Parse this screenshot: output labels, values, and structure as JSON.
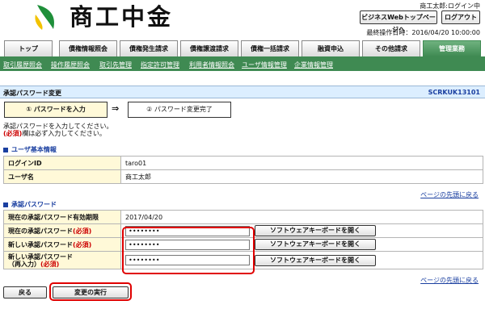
{
  "header": {
    "logo_text": "商工中金",
    "user_status": "商工太郎:ログイン中",
    "webtop_button": "ビジネスWebトップページへ",
    "logout_button": "ログアウト",
    "last_operation": "最終操作日時：2016/04/20 10:00:00"
  },
  "tabs": [
    {
      "label": "トップ"
    },
    {
      "label": "債権情報照会"
    },
    {
      "label": "債権発生請求"
    },
    {
      "label": "債権譲渡請求"
    },
    {
      "label": "債権一括請求"
    },
    {
      "label": "融資申込"
    },
    {
      "label": "その他請求"
    },
    {
      "label": "管理業務"
    }
  ],
  "submenu": [
    {
      "label": "取引履歴照会"
    },
    {
      "label": "操作履歴照会"
    },
    {
      "label": "取引先管理"
    },
    {
      "label": "指定許可管理"
    },
    {
      "label": "利用者情報照会"
    },
    {
      "label": "ユーザ情報管理"
    },
    {
      "label": "企業情報管理"
    }
  ],
  "page": {
    "title": "承認パスワード変更",
    "screen_id": "SCRKUK13101"
  },
  "steps": {
    "step1": "① パスワードを入力",
    "arrow": "⇒",
    "step2": "② パスワード変更完了"
  },
  "instructions": {
    "line1": "承認パスワードを入力してください。",
    "required_mark": "(必須)",
    "line2_rest": "欄は必ず入力してください。"
  },
  "user_info": {
    "heading": "ユーザ基本情報",
    "login_id_label": "ログインID",
    "login_id_value": "taro01",
    "user_name_label": "ユーザ名",
    "user_name_value": "商工太郎"
  },
  "page_top_link": "ページの先頭に戻る",
  "approval_pw": {
    "heading": "承認パスワード",
    "expiry_label": "現在の承認パスワード有効期限",
    "expiry_value": "2017/04/20",
    "current_label": "現在の承認パスワード",
    "new_label": "新しい承認パスワード",
    "new_confirm_label_line1": "新しい承認パスワード",
    "new_confirm_label_line2": "（再入力）",
    "required_mark": "(必須)",
    "masked_value": "••••••••",
    "keyboard_button": "ソフトウェアキーボードを開く"
  },
  "actions": {
    "back_button": "戻る",
    "execute_button": "変更の実行"
  },
  "colors": {
    "accent_green": "#3f8a52",
    "label_bg": "#fff9d8",
    "highlight_red": "#e00000",
    "link_blue": "#1a3fa0"
  }
}
